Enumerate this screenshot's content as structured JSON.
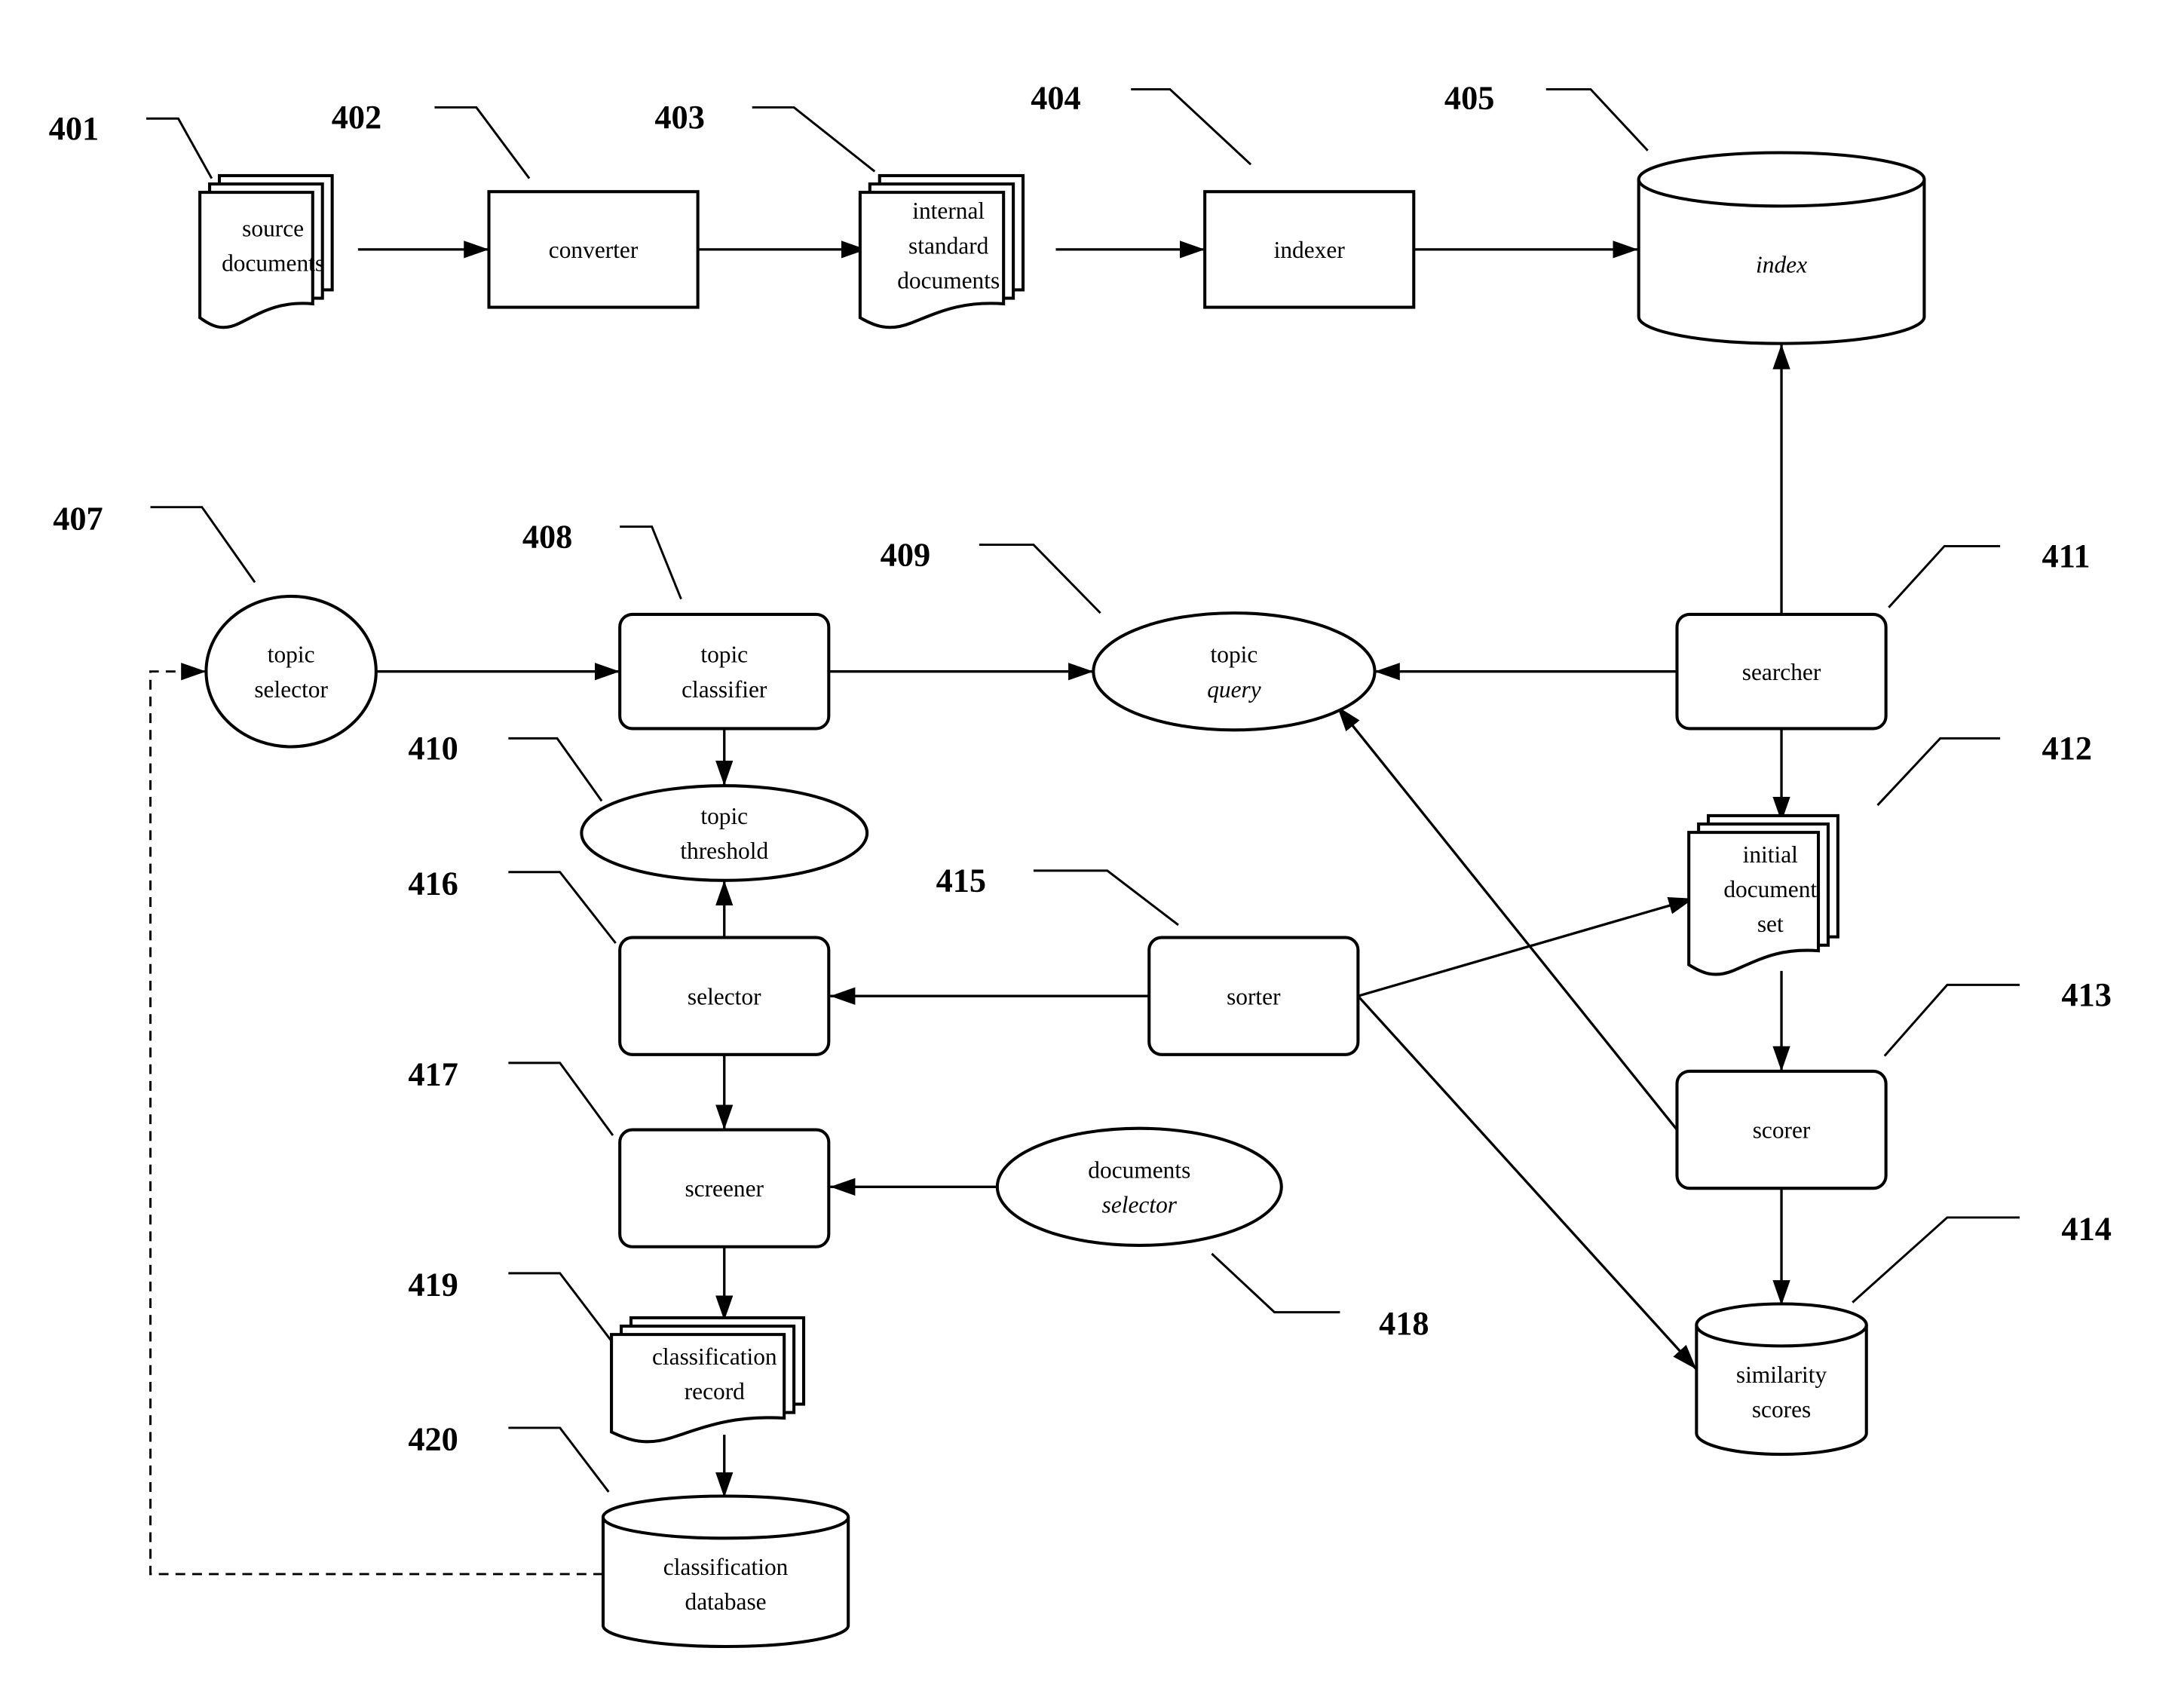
{
  "figure": {
    "nodes": [
      {
        "id": "401",
        "shape": "document-stack",
        "lines": [
          "source",
          "documents"
        ]
      },
      {
        "id": "402",
        "shape": "rectangle",
        "lines": [
          "converter"
        ]
      },
      {
        "id": "403",
        "shape": "document-stack",
        "lines": [
          "internal",
          "standard",
          "documents"
        ]
      },
      {
        "id": "404",
        "shape": "rectangle",
        "lines": [
          "indexer"
        ]
      },
      {
        "id": "405",
        "shape": "cylinder",
        "lines": [
          "index"
        ]
      },
      {
        "id": "407",
        "shape": "ellipse",
        "lines": [
          "topic",
          "selector"
        ]
      },
      {
        "id": "408",
        "shape": "rounded-rectangle",
        "lines": [
          "topic",
          "classifier"
        ]
      },
      {
        "id": "409",
        "shape": "ellipse",
        "lines": [
          "topic",
          "query"
        ]
      },
      {
        "id": "410",
        "shape": "ellipse",
        "lines": [
          "topic",
          "threshold"
        ]
      },
      {
        "id": "411",
        "shape": "rounded-rectangle",
        "lines": [
          "searcher"
        ]
      },
      {
        "id": "412",
        "shape": "document-stack",
        "lines": [
          "initial",
          "document",
          "set"
        ]
      },
      {
        "id": "413",
        "shape": "rounded-rectangle",
        "lines": [
          "scorer"
        ]
      },
      {
        "id": "414",
        "shape": "cylinder",
        "lines": [
          "similarity",
          "scores"
        ]
      },
      {
        "id": "415",
        "shape": "rounded-rectangle",
        "lines": [
          "sorter"
        ]
      },
      {
        "id": "416",
        "shape": "rounded-rectangle",
        "lines": [
          "selector"
        ]
      },
      {
        "id": "417",
        "shape": "rounded-rectangle",
        "lines": [
          "screener"
        ]
      },
      {
        "id": "418",
        "shape": "ellipse",
        "lines": [
          "documents",
          "selector"
        ]
      },
      {
        "id": "419",
        "shape": "document-stack",
        "lines": [
          "classification",
          "record"
        ]
      },
      {
        "id": "420",
        "shape": "cylinder",
        "lines": [
          "classification",
          "database"
        ]
      }
    ],
    "edges": [
      {
        "from": "401",
        "to": "402",
        "style": "solid"
      },
      {
        "from": "402",
        "to": "403",
        "style": "solid"
      },
      {
        "from": "403",
        "to": "404",
        "style": "solid"
      },
      {
        "from": "404",
        "to": "405",
        "style": "solid"
      },
      {
        "from": "411",
        "to": "405",
        "style": "solid"
      },
      {
        "from": "407",
        "to": "408",
        "style": "solid"
      },
      {
        "from": "408",
        "to": "409",
        "style": "solid"
      },
      {
        "from": "411",
        "to": "409",
        "style": "solid"
      },
      {
        "from": "413",
        "to": "409",
        "style": "solid"
      },
      {
        "from": "408",
        "to": "410",
        "style": "solid"
      },
      {
        "from": "416",
        "to": "410",
        "style": "solid"
      },
      {
        "from": "411",
        "to": "412",
        "style": "solid"
      },
      {
        "from": "415",
        "to": "412",
        "style": "solid"
      },
      {
        "from": "415",
        "to": "416",
        "style": "solid"
      },
      {
        "from": "415",
        "to": "414",
        "style": "solid"
      },
      {
        "from": "412",
        "to": "413",
        "style": "solid"
      },
      {
        "from": "413",
        "to": "414",
        "style": "solid"
      },
      {
        "from": "416",
        "to": "417",
        "style": "solid"
      },
      {
        "from": "418",
        "to": "417",
        "style": "solid"
      },
      {
        "from": "417",
        "to": "419",
        "style": "solid"
      },
      {
        "from": "419",
        "to": "420",
        "style": "solid"
      },
      {
        "from": "420",
        "to": "407",
        "style": "dashed"
      }
    ],
    "reference_numerals": [
      "401",
      "402",
      "403",
      "404",
      "405",
      "407",
      "408",
      "409",
      "410",
      "411",
      "412",
      "413",
      "414",
      "415",
      "416",
      "417",
      "418",
      "419",
      "420"
    ]
  }
}
